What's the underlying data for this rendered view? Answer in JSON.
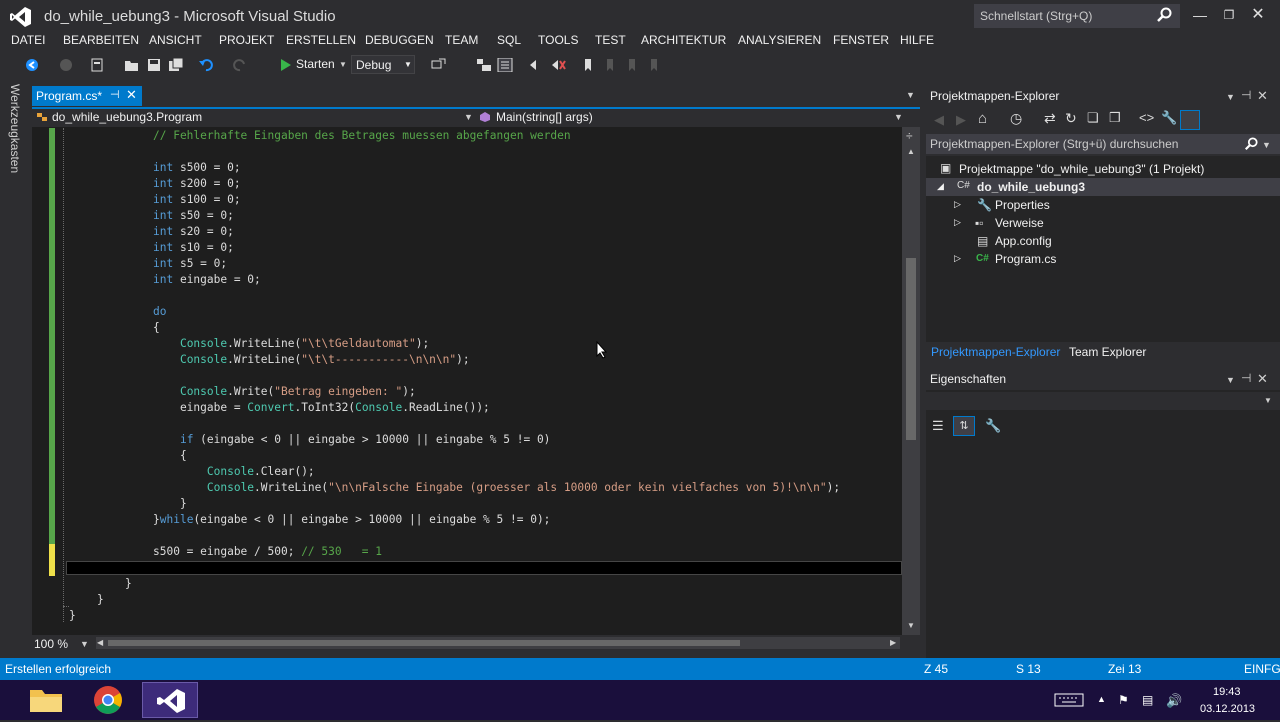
{
  "window": {
    "title": "do_while_uebung3 - Microsoft Visual Studio",
    "quicklaunch_placeholder": "Schnellstart (Strg+Q)"
  },
  "menu": [
    "DATEI",
    "BEARBEITEN",
    "ANSICHT",
    "PROJEKT",
    "ERSTELLEN",
    "DEBUGGEN",
    "TEAM",
    "SQL",
    "TOOLS",
    "TEST",
    "ARCHITEKTUR",
    "ANALYSIEREN",
    "FENSTER",
    "HILFE"
  ],
  "toolbar": {
    "start_label": "Starten",
    "config_value": "Debug"
  },
  "toolbox_label": "Werkzeugkasten",
  "document_tab": {
    "label": "Program.cs*"
  },
  "navbar": {
    "class_scope": "do_while_uebung3.Program",
    "member_scope": "Main(string[] args)"
  },
  "code_lines": [
    {
      "t": "// Fehlerhafte Eingaben des Betrages muessen abgefangen werden"
    },
    {
      "t": ""
    },
    {
      "t": "int s500 = 0;"
    },
    {
      "t": "int s200 = 0;"
    },
    {
      "t": "int s100 = 0;"
    },
    {
      "t": "int s50 = 0;"
    },
    {
      "t": "int s20 = 0;"
    },
    {
      "t": "int s10 = 0;"
    },
    {
      "t": "int s5 = 0;"
    },
    {
      "t": "int eingabe = 0;"
    },
    {
      "t": ""
    },
    {
      "t": "do"
    },
    {
      "t": "{"
    },
    {
      "t": "    Console.WriteLine(\"\\t\\tGeldautomat\");"
    },
    {
      "t": "    Console.WriteLine(\"\\t\\t-----------\\n\\n\\n\");"
    },
    {
      "t": ""
    },
    {
      "t": "    Console.Write(\"Betrag eingeben: \");"
    },
    {
      "t": "    eingabe = Convert.ToInt32(Console.ReadLine());"
    },
    {
      "t": ""
    },
    {
      "t": "    if (eingabe < 0 || eingabe > 10000 || eingabe % 5 != 0)"
    },
    {
      "t": "    {"
    },
    {
      "t": "        Console.Clear();"
    },
    {
      "t": "        Console.WriteLine(\"\\n\\nFalsche Eingabe (groesser als 10000 oder kein vielfaches von 5)!\\n\\n\");"
    },
    {
      "t": "    }"
    },
    {
      "t": "}while(eingabe < 0 || eingabe > 10000 || eingabe % 5 != 0);"
    },
    {
      "t": ""
    },
    {
      "t": "s500 = eingabe / 500; // 530   = 1"
    },
    {
      "t": ""
    },
    {
      "t": "    }"
    },
    {
      "t": "}"
    },
    {
      "t": "}"
    }
  ],
  "zoom": "100 %",
  "solution_explorer": {
    "title": "Projektmappen-Explorer",
    "search_placeholder": "Projektmappen-Explorer (Strg+ü) durchsuchen",
    "solution": "Projektmappe \"do_while_uebung3\" (1 Projekt)",
    "project": "do_while_uebung3",
    "items": [
      "Properties",
      "Verweise",
      "App.config",
      "Program.cs"
    ]
  },
  "panel_tabs": {
    "solution_explorer": "Projektmappen-Explorer",
    "team_explorer": "Team Explorer"
  },
  "properties": {
    "title": "Eigenschaften"
  },
  "status": {
    "message": "Erstellen erfolgreich",
    "line": "Z 45",
    "column": "S 13",
    "char": "Zei 13",
    "mode": "EINFG"
  },
  "clock": {
    "time": "19:43",
    "date": "03.12.2013"
  },
  "colors": {
    "accent": "#007acc",
    "keyword": "#569cd6",
    "type": "#4ec9b0",
    "string": "#d69d85",
    "comment": "#57a64a"
  }
}
